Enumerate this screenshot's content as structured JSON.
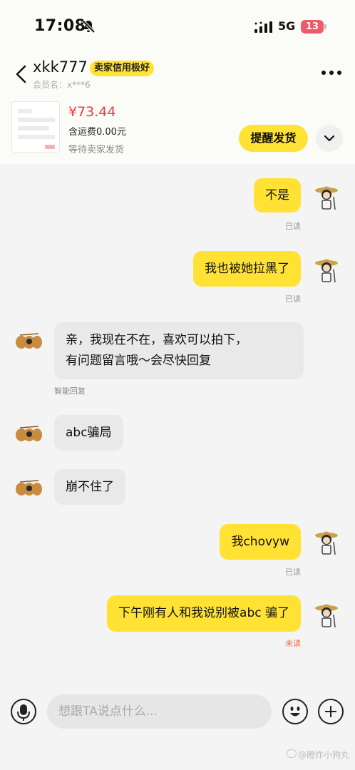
{
  "status_bar": {
    "time": "17:08",
    "network": "5G",
    "battery": "13"
  },
  "header": {
    "seller_name": "xkk777",
    "credit_badge": "卖家信用极好",
    "member_id": "会员名：x***6"
  },
  "order": {
    "price": "¥73.44",
    "shipping": "含运费0.00元",
    "status": "等待卖家发货",
    "remind_label": "提醒发货"
  },
  "messages": [
    {
      "side": "mine",
      "text": "不是",
      "receipt": "已读"
    },
    {
      "side": "mine",
      "text": "我也被她拉黑了",
      "receipt": "已读"
    },
    {
      "side": "theirs",
      "text": "亲，我现在不在，喜欢可以拍下，\n有问题留言哦～会尽快回复",
      "note": "智能回复"
    },
    {
      "side": "theirs",
      "text": "abc骗局"
    },
    {
      "side": "theirs",
      "text": "崩不住了"
    },
    {
      "side": "mine",
      "text": "我chovyw",
      "receipt": "已读"
    },
    {
      "side": "mine",
      "text": "下午刚有人和我说别被abc 骗了",
      "receipt": "未读"
    }
  ],
  "input_bar": {
    "placeholder": "想跟TA说点什么..."
  },
  "watermark": "@瞪炸小狗丸",
  "colors": {
    "accent": "#ffe233",
    "price": "#f03c3c",
    "unread": "#ec6a3a"
  }
}
